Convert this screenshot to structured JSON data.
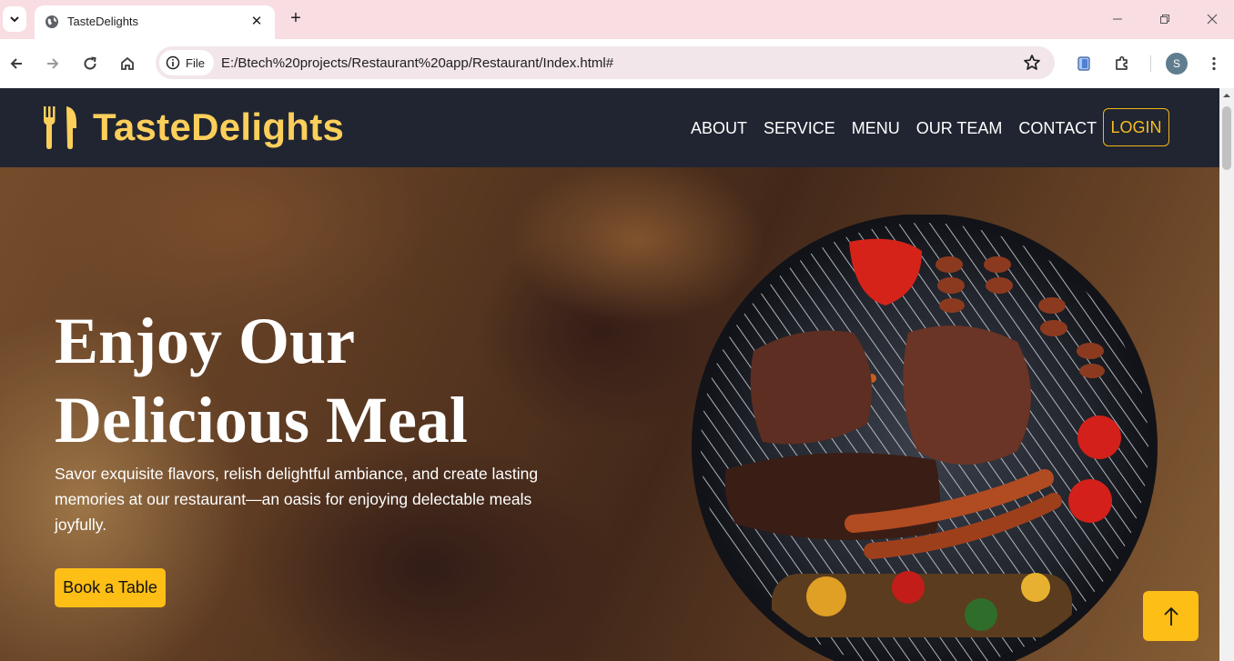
{
  "browser": {
    "tab_title": "TasteDelights",
    "new_tab_label": "+",
    "site_chip_label": "File",
    "url": "E:/Btech%20projects/Restaurant%20app/Restaurant/Index.html#",
    "profile_initial": "S"
  },
  "site": {
    "brand_name": "TasteDelights",
    "brand_color": "#fccf5b",
    "nav_links": [
      "ABOUT",
      "SERVICE",
      "MENU",
      "OUR TEAM",
      "CONTACT"
    ],
    "login_label": "LOGIN",
    "accent_color": "#fdbe16",
    "navbar_color": "#202531"
  },
  "hero": {
    "title_line1": "Enjoy Our",
    "title_line2": "Delicious Meal",
    "description": "Savor exquisite flavors, relish delightful ambiance, and create lasting memories at our restaurant—an oasis for enjoying delectable meals joyfully.",
    "cta_label": "Book a Table"
  },
  "icons": {
    "brand": "utensils-icon",
    "back_to_top": "arrow-up-icon"
  }
}
